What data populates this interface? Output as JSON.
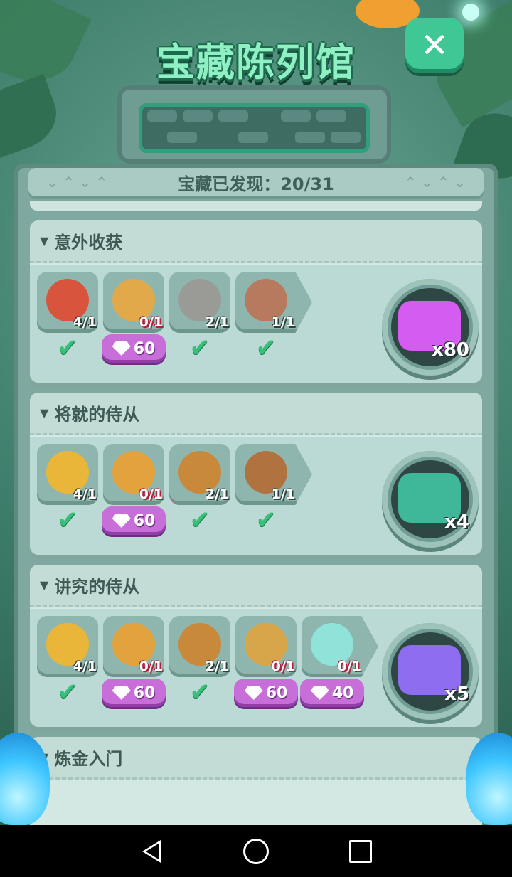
{
  "title": "宝藏陈列馆",
  "close_icon": "close-icon",
  "counter": "宝藏已发现：20/31",
  "colors": {
    "accent_green": "#3fc796",
    "gem_button": "#c76ed9",
    "check_green": "#35c17a",
    "panel_bg": "#d4e8e3"
  },
  "sections": [
    {
      "title": "意外收获",
      "items": [
        {
          "icon": "target-badge-icon",
          "count": "4/1",
          "owned": true,
          "art_color": "#d9543c"
        },
        {
          "icon": "bow-arrow-icon",
          "count": "0/1",
          "owned": false,
          "cost": "60",
          "art_color": "#e2a94a"
        },
        {
          "icon": "snake-stone-icon",
          "count": "2/1",
          "owned": true,
          "art_color": "#9a9a96"
        },
        {
          "icon": "fossil-stone-icon",
          "count": "1/1",
          "owned": true,
          "art_color": "#b77a5e"
        }
      ],
      "reward": {
        "icon": "purple-gems-icon",
        "qty": "x80",
        "art_color": "#d55cf0"
      }
    },
    {
      "title": "将就的侍从",
      "items": [
        {
          "icon": "mouse-shield-icon",
          "count": "4/1",
          "owned": true,
          "art_color": "#e9b63a"
        },
        {
          "icon": "gold-armor-icon",
          "count": "0/1",
          "owned": false,
          "cost": "60",
          "art_color": "#e2a23e"
        },
        {
          "icon": "belt-icon",
          "count": "2/1",
          "owned": true,
          "art_color": "#c8893a"
        },
        {
          "icon": "boots-icon",
          "count": "1/1",
          "owned": true,
          "art_color": "#b07340"
        }
      ],
      "reward": {
        "icon": "eye-ticket-icon",
        "qty": "x4",
        "art_color": "#3fb89a"
      }
    },
    {
      "title": "讲究的侍从",
      "items": [
        {
          "icon": "mouse-shield-icon",
          "count": "4/1",
          "owned": true,
          "art_color": "#e9b63a"
        },
        {
          "icon": "gold-armor-icon",
          "count": "0/1",
          "owned": false,
          "cost": "60",
          "art_color": "#e2a23e"
        },
        {
          "icon": "belt-icon",
          "count": "2/1",
          "owned": true,
          "art_color": "#c8893a"
        },
        {
          "icon": "mouse-crest-shield-icon",
          "count": "0/1",
          "owned": false,
          "cost": "60",
          "art_color": "#d8a64a"
        },
        {
          "icon": "crystal-sword-icon",
          "count": "0/1",
          "owned": false,
          "cost": "40",
          "art_color": "#8fe3d8"
        }
      ],
      "reward": {
        "icon": "mystery-box-icon",
        "qty": "x5",
        "art_color": "#8f6df0"
      }
    },
    {
      "title": "炼金入门"
    }
  ],
  "navbar": {
    "back": "back-icon",
    "home": "home-icon",
    "recents": "recents-icon"
  }
}
